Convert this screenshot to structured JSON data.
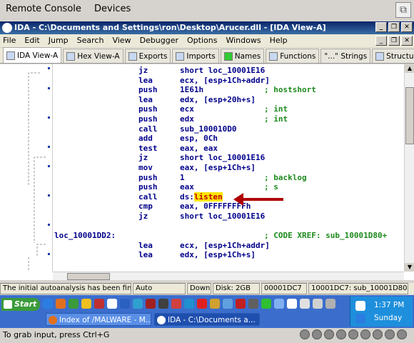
{
  "remote_console": {
    "menu": [
      "Remote Console",
      "Devices"
    ]
  },
  "ida": {
    "title": "IDA - C:\\Documents and Settings\\ron\\Desktop\\Arucer.dll - [IDA View-A]",
    "menu": [
      "File",
      "Edit",
      "Jump",
      "Search",
      "View",
      "Debugger",
      "Options",
      "Windows",
      "Help"
    ],
    "tabs": [
      "IDA View-A",
      "Hex View-A",
      "Exports",
      "Imports",
      "Names",
      "Functions",
      "\"...\" Strings",
      "Structu"
    ],
    "code": [
      {
        "mn": "jz",
        "op": "short loc_10001E16",
        "cm": ""
      },
      {
        "mn": "lea",
        "op": "ecx, [esp+1Ch+addr]",
        "cm": ""
      },
      {
        "mn": "push",
        "op": "1E61h",
        "cm": "; hostshort"
      },
      {
        "mn": "lea",
        "op": "edx, [esp+20h+s]",
        "cm": ""
      },
      {
        "mn": "push",
        "op": "ecx",
        "cm": "; int"
      },
      {
        "mn": "push",
        "op": "edx",
        "cm": "; int"
      },
      {
        "mn": "call",
        "op": "sub_100010D0",
        "cm": ""
      },
      {
        "mn": "add",
        "op": "esp, 0Ch",
        "cm": ""
      },
      {
        "mn": "test",
        "op": "eax, eax",
        "cm": ""
      },
      {
        "mn": "jz",
        "op": "short loc_10001E16",
        "cm": ""
      },
      {
        "mn": "mov",
        "op": "eax, [esp+1Ch+s]",
        "cm": ""
      },
      {
        "mn": "push",
        "op": "1",
        "cm": "; backlog"
      },
      {
        "mn": "push",
        "op": "eax",
        "cm": "; s"
      },
      {
        "mn": "call",
        "op_prefix": "ds:",
        "op_hl": "listen",
        "cm": ""
      },
      {
        "mn": "cmp",
        "op": "eax, 0FFFFFFFFh",
        "cm": ""
      },
      {
        "mn": "jz",
        "op": "short loc_10001E16",
        "cm": ""
      },
      {
        "blank": true
      },
      {
        "label": "loc_10001DD2:",
        "cm": "; CODE XREF: sub_10001D80+"
      },
      {
        "mn": "lea",
        "op": "ecx, [esp+1Ch+addr]",
        "cm": ""
      },
      {
        "mn": "lea",
        "op": "edx, [esp+1Ch+s]",
        "cm": ""
      }
    ],
    "status": [
      "The initial autoanalysis has been finished.",
      "Auto",
      "Down",
      "Disk: 2GB",
      "00001DC7",
      "10001DC7: sub_10001D80+"
    ]
  },
  "taskbar": {
    "start": "Start",
    "tasks": [
      "Index of /MALWARE - M...",
      "IDA - C:\\Documents a..."
    ],
    "clock": "1:37 PM",
    "day": "Sunday"
  },
  "hint": "To grab input, press Ctrl+G"
}
